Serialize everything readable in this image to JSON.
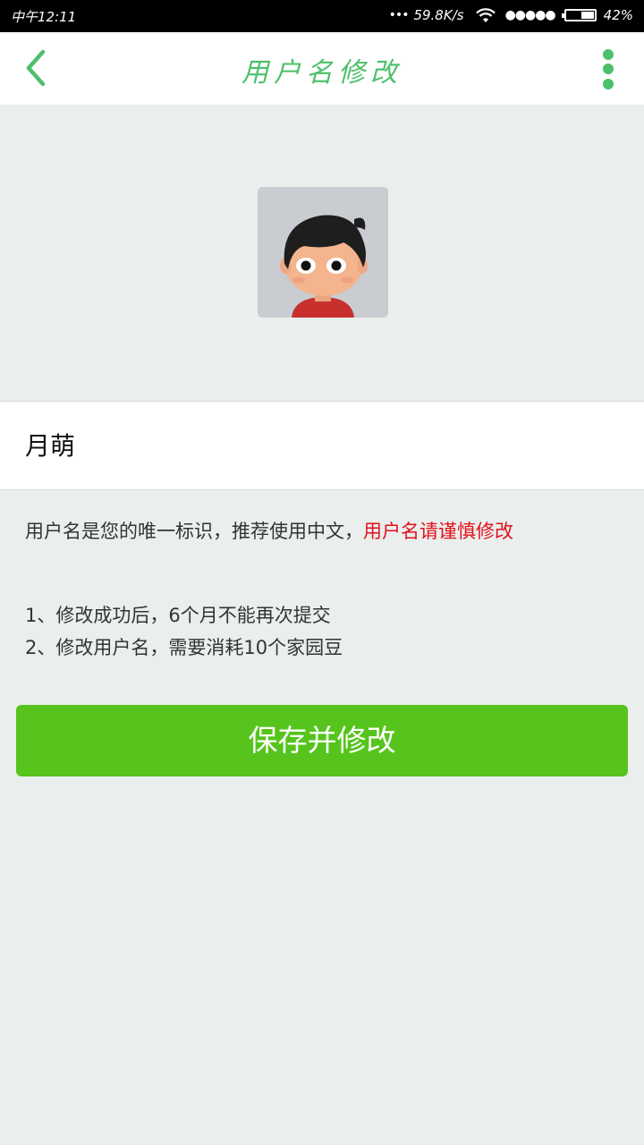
{
  "status_bar": {
    "time": "中午12:11",
    "net_speed": "59.8K/s",
    "battery_text": "42%",
    "battery_level": 0.42,
    "icons": [
      "more-dots-icon",
      "wifi-icon",
      "signal-icon",
      "battery-icon"
    ]
  },
  "app_bar": {
    "title": "用户名修改",
    "back_icon": "chevron-left-icon",
    "menu_icon": "more-vert-icon",
    "accent_color": "#4cc06a"
  },
  "profile": {
    "username": "月萌"
  },
  "hint": {
    "text": "用户名是您的唯一标识，推荐使用中文，",
    "warning": "用户名请谨慎修改",
    "warning_color": "#e4101b"
  },
  "rules": [
    "1、修改成功后，6个月不能再次提交",
    "2、修改用户名，需要消耗10个家园豆"
  ],
  "save_button": {
    "label": "保存并修改",
    "color": "#56c41c"
  }
}
